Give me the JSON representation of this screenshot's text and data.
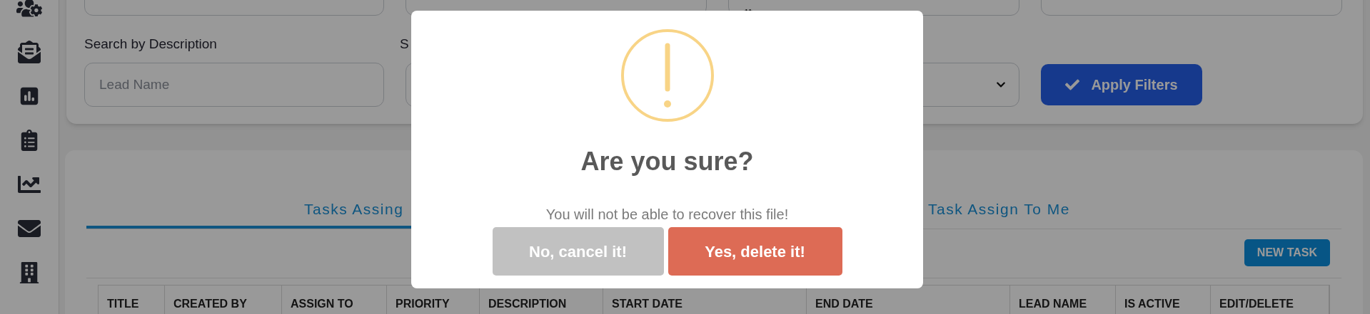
{
  "sidebar": {
    "items": [
      {
        "kind": "users-gear"
      },
      {
        "kind": "mail-open"
      },
      {
        "kind": "chart-square"
      },
      {
        "kind": "clipboard"
      },
      {
        "kind": "line-chart"
      },
      {
        "kind": "mail"
      },
      {
        "kind": "building"
      }
    ]
  },
  "filters": {
    "label_1": "Search by Description",
    "label_2": "S",
    "description_field": {
      "placeholder": "Lead Name"
    },
    "apply_button": "Apply Filters"
  },
  "tabs": [
    {
      "label": "Tasks Assing",
      "selected": true
    },
    {
      "label": "Task Assign To Me",
      "selected": false
    }
  ],
  "new_task_button": "NEW TASK",
  "table": {
    "columns": [
      "TITLE",
      "CREATED BY",
      "ASSIGN TO",
      "PRIORITY",
      "DESCRIPTION",
      "START DATE",
      "END DATE",
      "LEAD NAME",
      "IS ACTIVE",
      "EDIT/DELETE"
    ]
  },
  "dialog": {
    "title": "Are you sure?",
    "text": "You will not be able to recover this file!",
    "cancel_button": "No, cancel it!",
    "confirm_button": "Yes, delete it!"
  }
}
